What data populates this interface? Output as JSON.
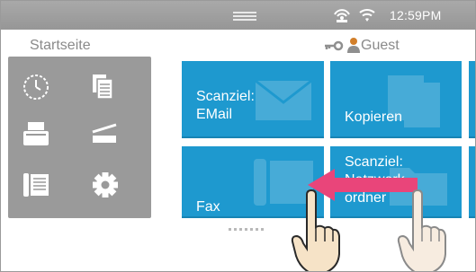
{
  "status_bar": {
    "time": "12:59PM",
    "icons": [
      "network-icon",
      "wifi-icon"
    ]
  },
  "header": {
    "title": "Startseite",
    "user": "Guest"
  },
  "quick_panel": {
    "icons": [
      "clock-icon",
      "copy-icon",
      "printer-icon",
      "scanner-icon",
      "fax-icon",
      "settings-icon"
    ]
  },
  "tiles": [
    {
      "label": "Scanziel:\nEMail",
      "icon": "email-icon"
    },
    {
      "label": "Kopieren",
      "icon": "copy-icon"
    },
    {
      "label": "Fax",
      "icon": "fax-icon"
    },
    {
      "label": "Scanziel:\nNetzwerk-\nordner",
      "icon": "folder-icon"
    }
  ],
  "gesture": {
    "type": "swipe-left",
    "icons": [
      "swipe-arrow-icon",
      "hand-icon"
    ]
  },
  "colors": {
    "status_bar": "#a0a0a0",
    "tile": "#1e99cf",
    "quick_panel": "#9a9a9a",
    "swipe_arrow": "#e9457a"
  }
}
